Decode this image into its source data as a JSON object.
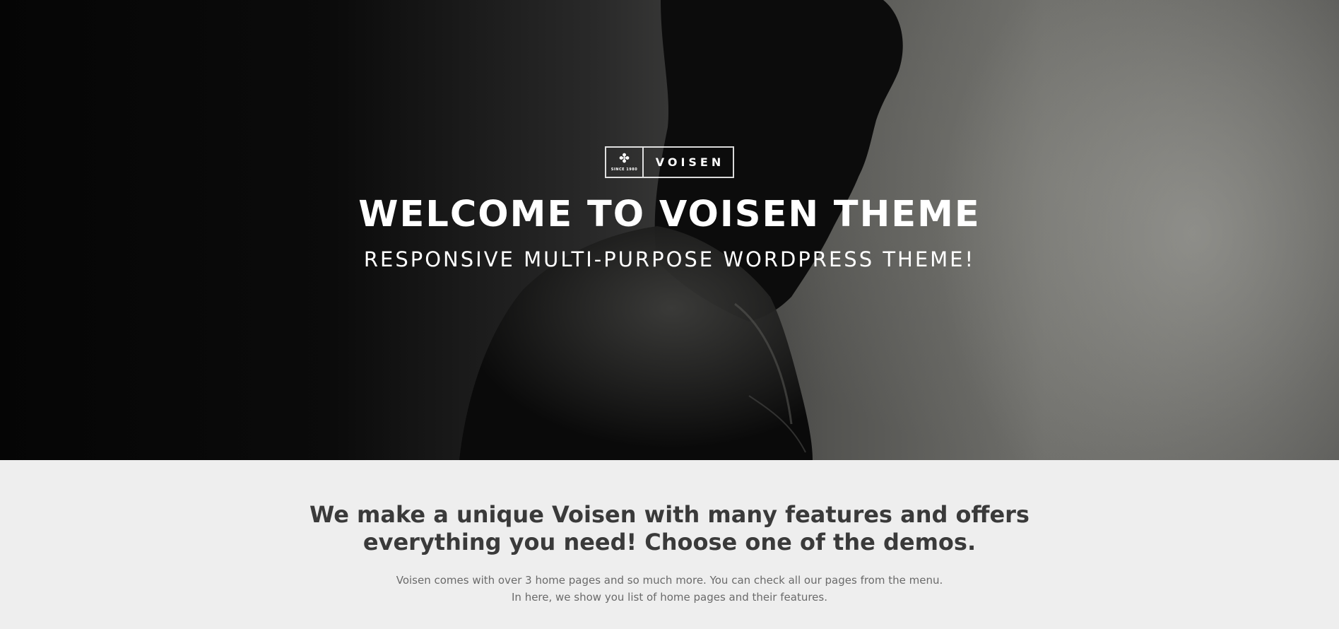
{
  "hero": {
    "logo": {
      "since_text": "SINCE 1980",
      "wordmark": "VOISEN",
      "icon": "maple-leaf-icon"
    },
    "title": "WELCOME TO VOISEN THEME",
    "subtitle": "RESPONSIVE MULTI-PURPOSE WORDPRESS THEME!"
  },
  "intro": {
    "heading": "We make a unique Voisen with many features and offers everything you need! Choose one of the demos.",
    "text_line_1": "Voisen comes with over 3 home pages and so much more. You can check all our pages from the menu.",
    "text_line_2": "In here, we show you list of home pages and their features."
  },
  "colors": {
    "intro_background": "#eeeeee",
    "heading_text": "#3a3a3a",
    "body_text": "#6a6a6a",
    "hero_text": "#ffffff"
  }
}
